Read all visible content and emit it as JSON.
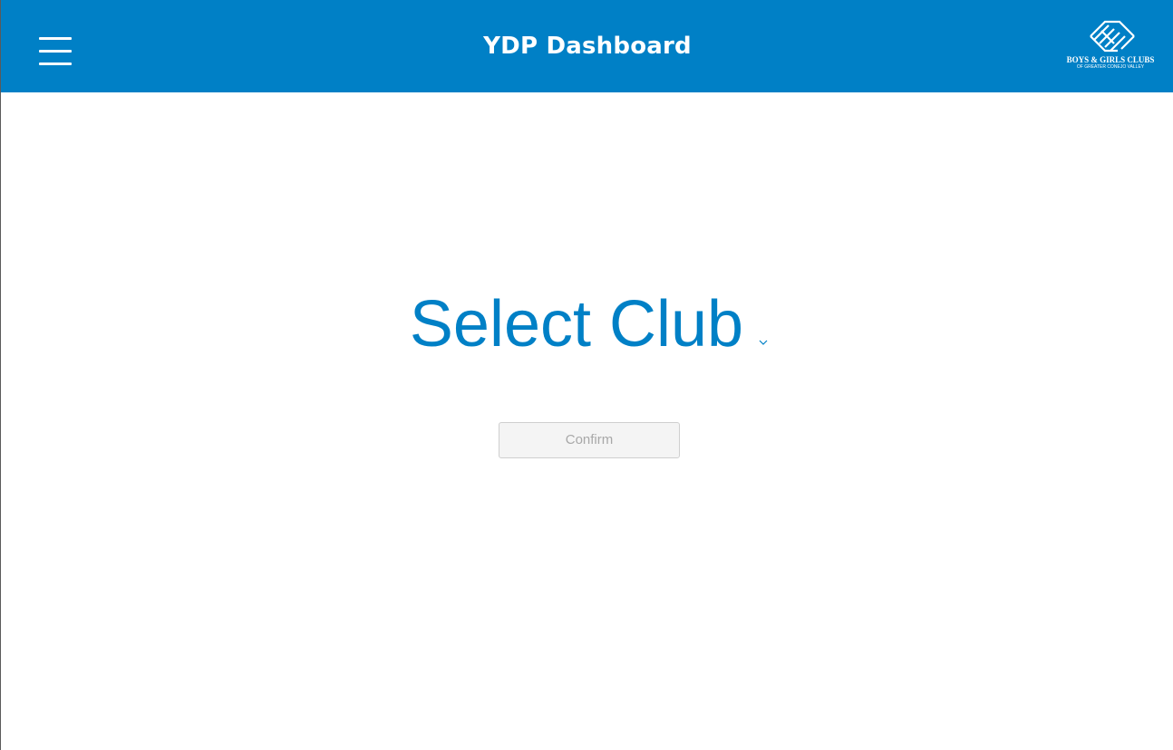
{
  "header": {
    "title": "YDP Dashboard",
    "menu_icon": "hamburger-menu-icon",
    "background_color": "#0080c6",
    "logo": {
      "name": "boys-and-girls-clubs-logo",
      "line1": "BOYS & GIRLS CLUBS",
      "line2": "OF GREATER CONEJO VALLEY"
    }
  },
  "main": {
    "club_select": {
      "label": "Select Club",
      "icon": "chevron-down-icon",
      "color": "#0080c6"
    },
    "confirm_button": {
      "label": "Confirm",
      "state": "disabled"
    }
  }
}
